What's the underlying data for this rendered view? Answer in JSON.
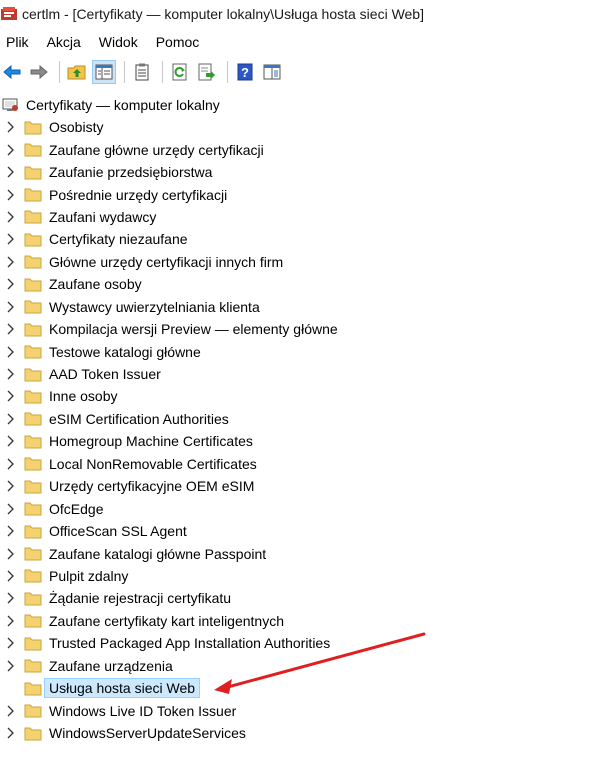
{
  "window": {
    "title": "certlm - [Certyfikaty — komputer lokalny\\Usługa hosta sieci Web]"
  },
  "menu": [
    "Plik",
    "Akcja",
    "Widok",
    "Pomoc"
  ],
  "toolbar": {
    "icons": [
      "back-icon",
      "forward-icon",
      "up-folder-icon",
      "show-hide-tree-icon",
      "export-list-icon",
      "refresh-icon",
      "export-icon",
      "help-icon",
      "properties-icon"
    ]
  },
  "tree": {
    "root_label": "Certyfikaty — komputer lokalny",
    "items": [
      {
        "label": "Osobisty"
      },
      {
        "label": "Zaufane główne urzędy certyfikacji"
      },
      {
        "label": "Zaufanie przedsiębiorstwa"
      },
      {
        "label": "Pośrednie urzędy certyfikacji"
      },
      {
        "label": "Zaufani wydawcy"
      },
      {
        "label": "Certyfikaty niezaufane"
      },
      {
        "label": "Główne urzędy certyfikacji innych firm"
      },
      {
        "label": "Zaufane osoby"
      },
      {
        "label": "Wystawcy uwierzytelniania klienta"
      },
      {
        "label": "Kompilacja wersji Preview — elementy główne"
      },
      {
        "label": "Testowe katalogi główne"
      },
      {
        "label": "AAD Token Issuer"
      },
      {
        "label": "Inne osoby"
      },
      {
        "label": "eSIM Certification Authorities"
      },
      {
        "label": "Homegroup Machine Certificates"
      },
      {
        "label": "Local NonRemovable Certificates"
      },
      {
        "label": "Urzędy certyfikacyjne OEM eSIM"
      },
      {
        "label": "OfcEdge"
      },
      {
        "label": "OfficeScan SSL Agent"
      },
      {
        "label": "Zaufane katalogi główne Passpoint"
      },
      {
        "label": "Pulpit zdalny"
      },
      {
        "label": "Żądanie rejestracji certyfikatu"
      },
      {
        "label": "Zaufane certyfikaty kart inteligentnych"
      },
      {
        "label": "Trusted Packaged App Installation Authorities"
      },
      {
        "label": "Zaufane urządzenia"
      },
      {
        "label": "Usługa hosta sieci Web",
        "selected": true,
        "expandable": false
      },
      {
        "label": "Windows Live ID Token Issuer"
      },
      {
        "label": "WindowsServerUpdateServices"
      }
    ]
  },
  "colors": {
    "annotation_arrow": "#e02020",
    "selection_bg": "#cce8ff",
    "folder": "#f5d270"
  }
}
